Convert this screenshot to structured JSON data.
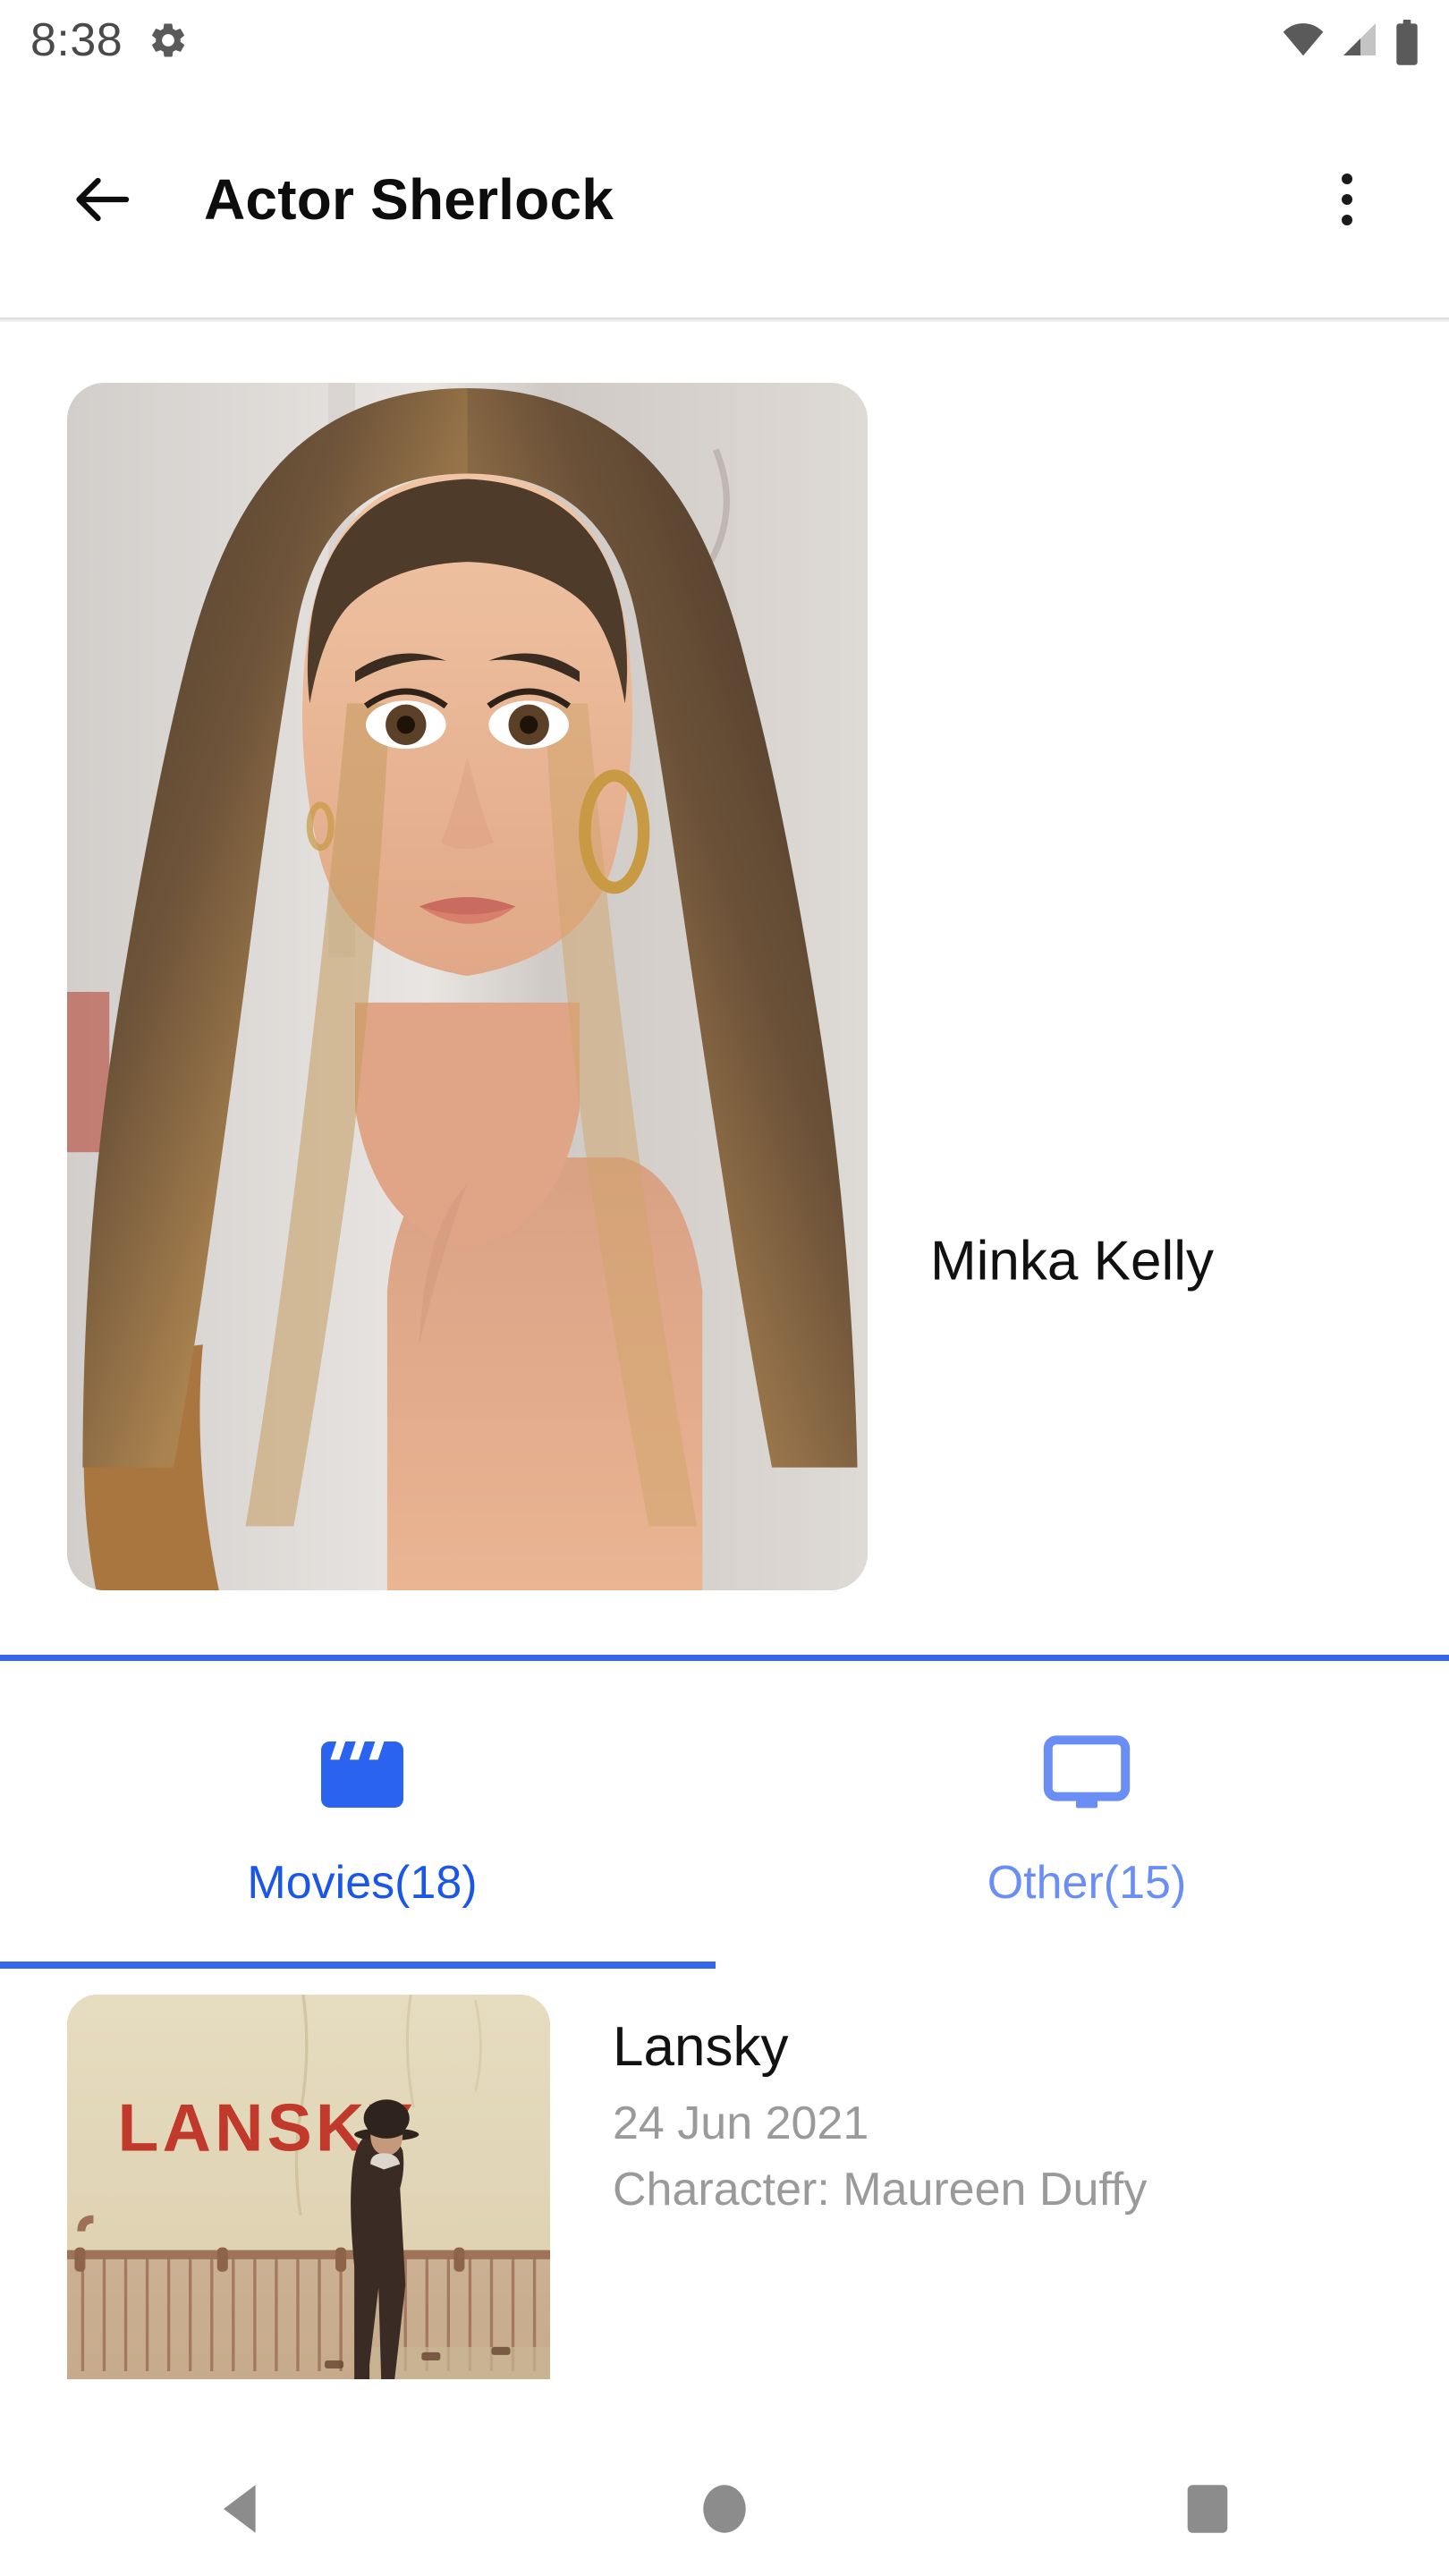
{
  "status_bar": {
    "time": "8:38",
    "icons": [
      "gear-icon",
      "wifi-icon",
      "signal-icon",
      "battery-icon"
    ]
  },
  "app_bar": {
    "back_icon": "back-arrow-icon",
    "title": "Actor Sherlock",
    "overflow_icon": "overflow-menu-icon"
  },
  "profile": {
    "actor_name": "Minka Kelly",
    "photo_alt": "Minka Kelly portrait"
  },
  "tabs": [
    {
      "label": "Movies(18)",
      "icon": "movie-clapperboard-icon",
      "selected": true
    },
    {
      "label": "Other(15)",
      "icon": "tv-monitor-icon",
      "selected": false
    }
  ],
  "movies": [
    {
      "title": "Lansky",
      "date": "24 Jun 2021",
      "character": "Character: Maureen Duffy",
      "poster_text": "LANSKY"
    }
  ],
  "nav_bar": {
    "back": "nav-back-icon",
    "home": "nav-home-icon",
    "recents": "nav-recents-icon"
  },
  "colors": {
    "accent_blue": "#3468e8",
    "tab_selected": "#1a56e8",
    "tab_unselected": "#6b8ef5",
    "title_text": "#0d0d0d",
    "secondary_text": "#9a9a9a",
    "status_icon": "#5a5a5a",
    "poster_red": "#c0392b"
  }
}
